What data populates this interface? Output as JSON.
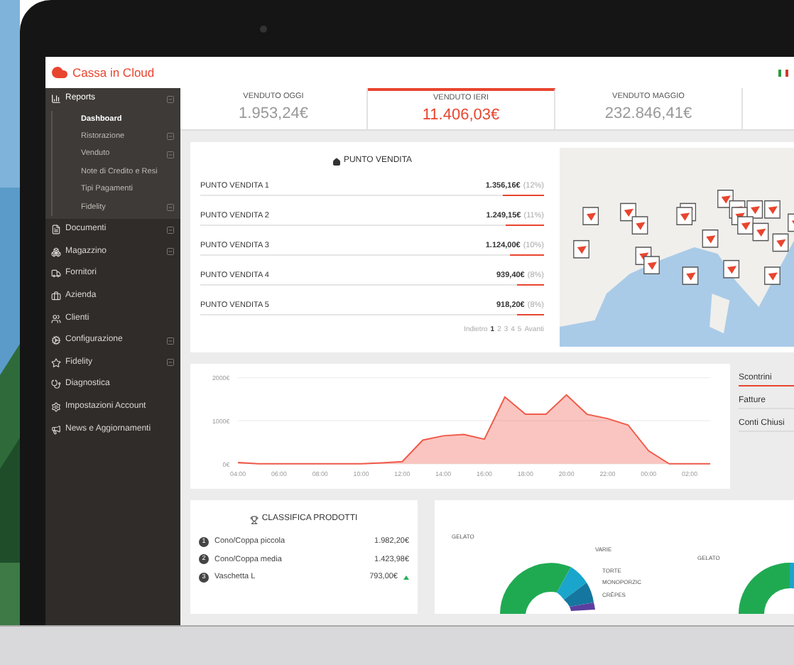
{
  "logo": {
    "text": "Cassa in Cloud"
  },
  "sidebar": {
    "items": [
      {
        "label": "Reports",
        "expandable": true,
        "expanded": true,
        "children": [
          {
            "label": "Dashboard",
            "selected": true,
            "expandable": false
          },
          {
            "label": "Ristorazione",
            "selected": false,
            "expandable": true
          },
          {
            "label": "Venduto",
            "selected": false,
            "expandable": true
          },
          {
            "label": "Note di Credito e Resi",
            "selected": false,
            "expandable": false
          },
          {
            "label": "Tipi Pagamenti",
            "selected": false,
            "expandable": false
          },
          {
            "label": "Fidelity",
            "selected": false,
            "expandable": true
          }
        ]
      },
      {
        "label": "Documenti",
        "expandable": true,
        "expanded": false
      },
      {
        "label": "Magazzino",
        "expandable": true,
        "expanded": false
      },
      {
        "label": "Fornitori",
        "expandable": false,
        "expanded": false
      },
      {
        "label": "Azienda",
        "expandable": false,
        "expanded": false
      },
      {
        "label": "Clienti",
        "expandable": false,
        "expanded": false
      },
      {
        "label": "Configurazione",
        "expandable": true,
        "expanded": false
      },
      {
        "label": "Fidelity",
        "expandable": true,
        "expanded": false
      },
      {
        "label": "Diagnostica",
        "expandable": false,
        "expanded": false
      },
      {
        "label": "Impostazioni Account",
        "expandable": false,
        "expanded": false
      },
      {
        "label": "News e Aggiornamenti",
        "expandable": false,
        "expanded": false
      }
    ]
  },
  "stats": [
    {
      "label": "VENDUTO OGGI",
      "value": "1.953,24€",
      "selected": false
    },
    {
      "label": "VENDUTO IERI",
      "value": "11.406,03€",
      "selected": true
    },
    {
      "label": "VENDUTO MAGGIO",
      "value": "232.846,41€",
      "selected": false
    }
  ],
  "stores": {
    "title": "PUNTO VENDITA",
    "rows": [
      {
        "name": "PUNTO VENDITA 1",
        "amount": "1.356,16€",
        "percent": "(12%)",
        "level": 0.12
      },
      {
        "name": "PUNTO VENDITA 2",
        "amount": "1.249,15€",
        "percent": "(11%)",
        "level": 0.11
      },
      {
        "name": "PUNTO VENDITA 3",
        "amount": "1.124,00€",
        "percent": "(10%)",
        "level": 0.1
      },
      {
        "name": "PUNTO VENDITA 4",
        "amount": "939,40€",
        "percent": "(8%)",
        "level": 0.08
      },
      {
        "name": "PUNTO VENDITA 5",
        "amount": "918,20€",
        "percent": "(8%)",
        "level": 0.08
      }
    ],
    "pagination": [
      {
        "label": "Indietro",
        "selected": false
      },
      {
        "label": "1",
        "selected": true
      },
      {
        "label": "2",
        "selected": false
      },
      {
        "label": "3",
        "selected": false
      },
      {
        "label": "4",
        "selected": false
      },
      {
        "label": "5",
        "selected": false
      },
      {
        "label": "Avanti",
        "selected": false
      }
    ]
  },
  "sales_chart": {
    "chart_data": {
      "type": "area",
      "categories": [
        "04:00",
        null,
        "06:00",
        null,
        "08:00",
        null,
        "10:00",
        null,
        "12:00",
        null,
        "14:00",
        null,
        "16:00",
        null,
        "18:00",
        null,
        "20:00",
        null,
        "22:00",
        null,
        "00:00",
        null,
        "02:00",
        null
      ],
      "series": [
        {
          "color": "#f05a4a",
          "values": [
            30,
            0,
            0,
            0,
            0,
            0,
            0,
            20,
            50,
            550,
            650,
            680,
            570,
            1550,
            1150,
            1150,
            1600,
            1150,
            1050,
            900,
            300,
            0,
            0,
            0
          ]
        }
      ],
      "ylim": [
        0,
        2000
      ],
      "yticks": [
        {
          "value": 0,
          "label": "0€"
        },
        {
          "value": 1000,
          "label": "1000€"
        },
        {
          "value": 2000,
          "label": "2000€"
        }
      ]
    },
    "legend": [
      {
        "label": "Scontrini",
        "selected": true
      },
      {
        "label": "Fatture",
        "selected": false
      },
      {
        "label": "Conti Chiusi",
        "selected": false
      }
    ]
  },
  "ranking": {
    "title": "CLASSIFICA PRODOTTI",
    "rows": [
      {
        "rank": "1",
        "name": "Cono/Coppa piccola",
        "amount": "1.982,20€",
        "rising": false
      },
      {
        "rank": "2",
        "name": "Cono/Coppa media",
        "amount": "1.423,98€",
        "rising": false
      },
      {
        "rank": "3",
        "name": "Vaschetta L",
        "amount": "793,00€",
        "rising": true
      }
    ]
  },
  "categories": {
    "donut_labels": [
      "GELATO",
      "VARIE",
      "TORTE",
      "MONOPORZIC",
      "CRÊPES"
    ],
    "second_donut_labels": [
      "GELATO"
    ]
  }
}
